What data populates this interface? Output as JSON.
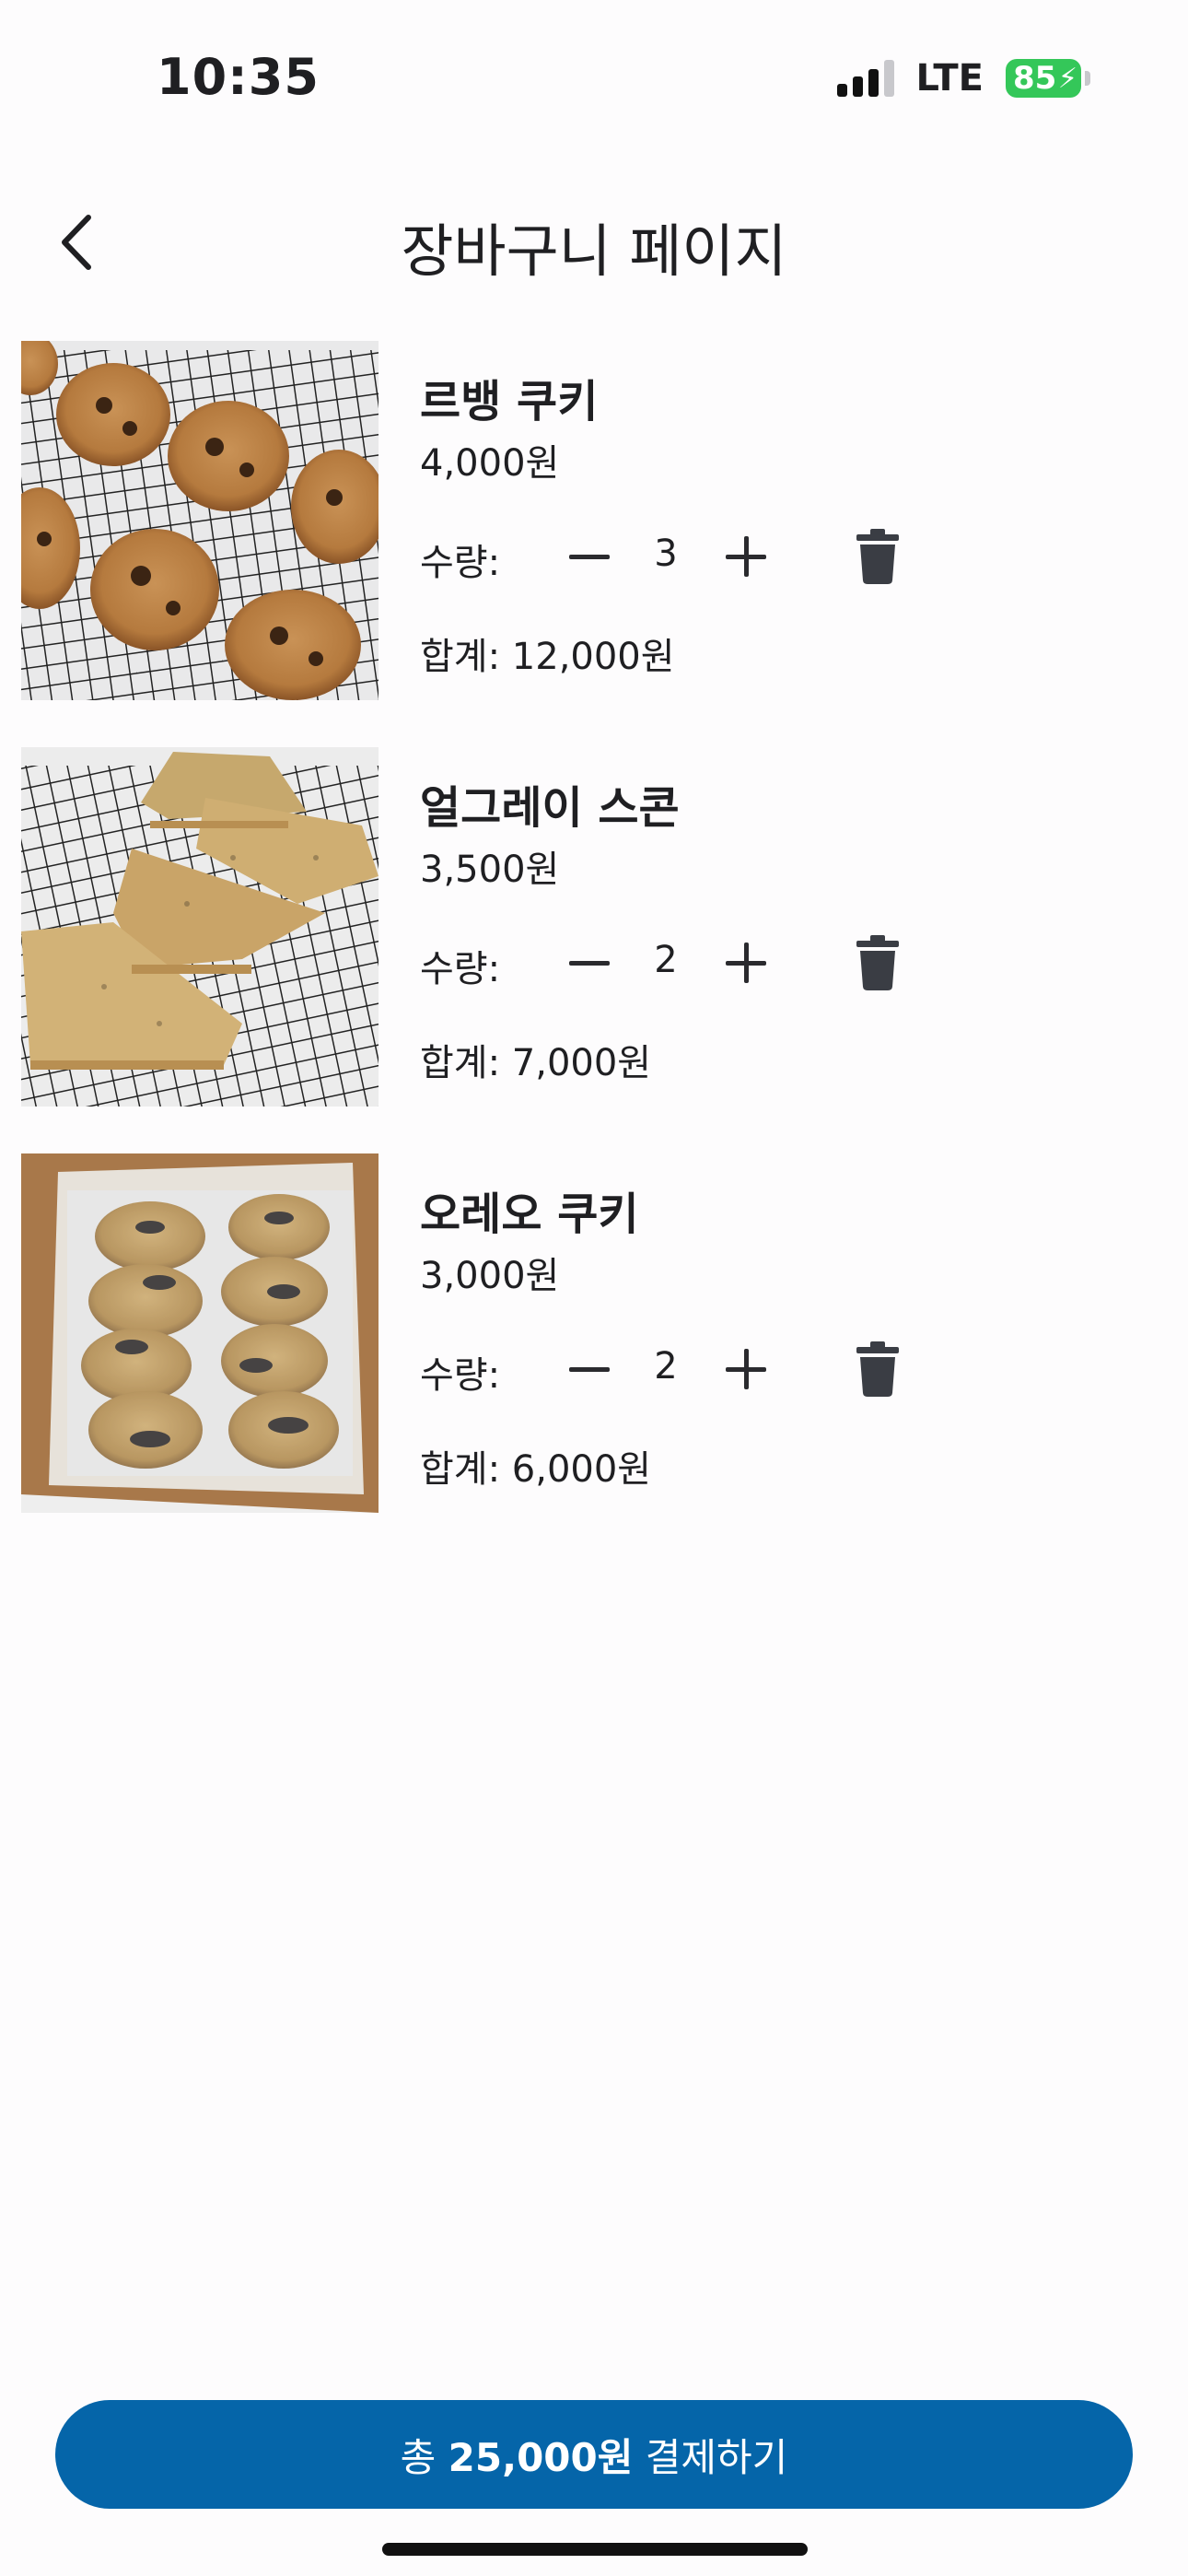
{
  "status_bar": {
    "time": "10:35",
    "network": "LTE",
    "battery": "85"
  },
  "header": {
    "title": "장바구니 페이지",
    "back_icon": "chevron-left-icon"
  },
  "cart": {
    "items": [
      {
        "name": "르뱅 쿠키",
        "price": "4,000원",
        "qty_label": "수량:",
        "qty": "3",
        "subtotal": "합계: 12,000원"
      },
      {
        "name": "얼그레이 스콘",
        "price": "3,500원",
        "qty_label": "수량:",
        "qty": "2",
        "subtotal": "합계: 7,000원"
      },
      {
        "name": "오레오 쿠키",
        "price": "3,000원",
        "qty_label": "수량:",
        "qty": "2",
        "subtotal": "합계: 6,000원"
      }
    ]
  },
  "checkout": {
    "prefix": "총 ",
    "amount": "25,000원",
    "suffix": " 결제하기"
  },
  "colors": {
    "accent": "#0565a9",
    "battery": "#34c759",
    "icon": "#3a3d44"
  }
}
